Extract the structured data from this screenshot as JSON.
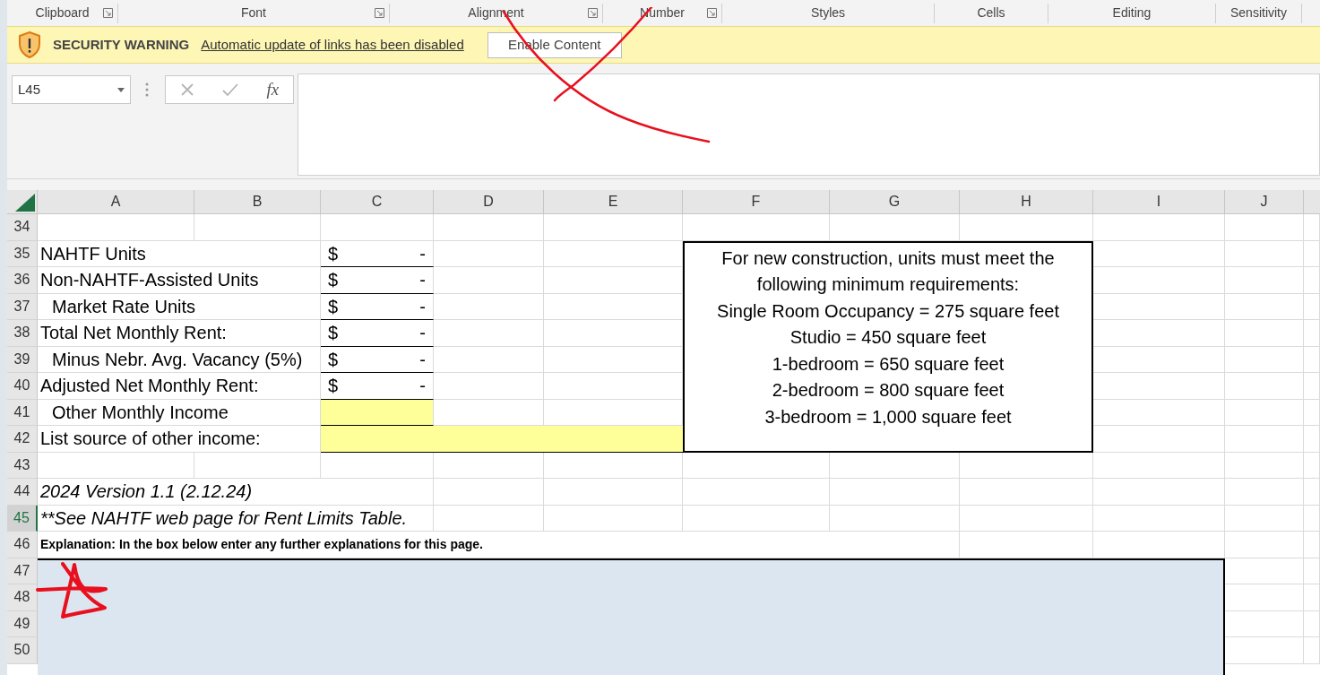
{
  "ribbon_groups": [
    {
      "label": "Clipboard",
      "launcher": true
    },
    {
      "label": "Font",
      "launcher": true
    },
    {
      "label": "Alignment",
      "launcher": true
    },
    {
      "label": "Number",
      "launcher": true
    },
    {
      "label": "Styles",
      "launcher": false
    },
    {
      "label": "Cells",
      "launcher": false
    },
    {
      "label": "Editing",
      "launcher": false
    },
    {
      "label": "Sensitivity",
      "launcher": false
    }
  ],
  "security_bar": {
    "title": "SECURITY WARNING",
    "message": "Automatic update of links has been disabled",
    "button": "Enable Content"
  },
  "formula_bar": {
    "name_box": "L45",
    "function_label": "fx"
  },
  "columns": [
    "A",
    "B",
    "C",
    "D",
    "E",
    "F",
    "G",
    "H",
    "I",
    "J"
  ],
  "rows": [
    {
      "number": "34",
      "selected": false,
      "kind": "blank"
    },
    {
      "number": "35",
      "selected": false,
      "kind": "amount",
      "label": "NAHTF Units",
      "indent": false,
      "currency": "$",
      "value": "-"
    },
    {
      "number": "36",
      "selected": false,
      "kind": "amount",
      "label": "Non-NAHTF-Assisted Units",
      "indent": false,
      "currency": "$",
      "value": "-"
    },
    {
      "number": "37",
      "selected": false,
      "kind": "amount",
      "label": "Market Rate Units",
      "indent": true,
      "currency": "$",
      "value": "-"
    },
    {
      "number": "38",
      "selected": false,
      "kind": "amount",
      "label": "Total Net Monthly Rent:",
      "indent": false,
      "currency": "$",
      "value": "-"
    },
    {
      "number": "39",
      "selected": false,
      "kind": "amount",
      "label": "Minus Nebr. Avg. Vacancy (5%)",
      "indent": true,
      "currency": "$",
      "value": "-"
    },
    {
      "number": "40",
      "selected": false,
      "kind": "amount",
      "label": "Adjusted Net Monthly Rent:",
      "indent": false,
      "currency": "$",
      "value": "-"
    },
    {
      "number": "41",
      "selected": false,
      "kind": "short_input",
      "label": "Other Monthly Income",
      "indent": true
    },
    {
      "number": "42",
      "selected": false,
      "kind": "long_input",
      "label": "List source of other income:",
      "indent": false
    },
    {
      "number": "43",
      "selected": false,
      "kind": "blank"
    },
    {
      "number": "44",
      "selected": false,
      "kind": "italic_note",
      "label": "2024 Version 1.1 (2.12.24)",
      "indent": false
    },
    {
      "number": "45",
      "selected": true,
      "kind": "italic_note",
      "label": "**See NAHTF web page for Rent Limits Table.",
      "indent": false
    },
    {
      "number": "46",
      "selected": false,
      "kind": "bold_note",
      "label": "Explanation:  In the box below enter any further explanations for this page.",
      "indent": false
    },
    {
      "number": "47",
      "selected": false,
      "kind": "blank"
    },
    {
      "number": "48",
      "selected": false,
      "kind": "blank"
    },
    {
      "number": "49",
      "selected": false,
      "kind": "blank"
    },
    {
      "number": "50",
      "selected": false,
      "kind": "blank"
    }
  ],
  "requirements_box": [
    "For new construction, units must meet the",
    "following minimum requirements:",
    "Single Room Occupancy = 275 square feet",
    "Studio = 450 square feet",
    "1-bedroom = 650 square feet",
    "2-bedroom = 800 square feet",
    "3-bedroom = 1,000 square feet"
  ]
}
